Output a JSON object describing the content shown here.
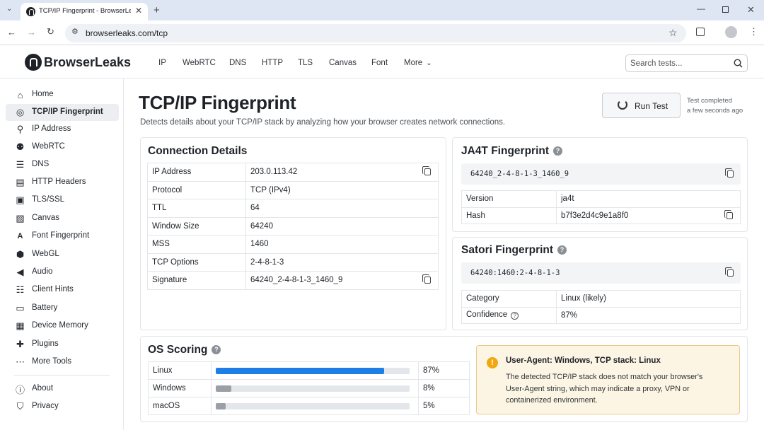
{
  "browser": {
    "tab_title": "TCP/IP Fingerprint - BrowserLeaks",
    "url": "browserleaks.com/tcp"
  },
  "site": {
    "brand": "BrowserLeaks",
    "nav": [
      "IP",
      "WebRTC",
      "DNS",
      "HTTP",
      "TLS",
      "Canvas",
      "Font",
      "More"
    ],
    "search_placeholder": "Search tests..."
  },
  "sidebar": {
    "items": [
      {
        "label": "Home",
        "icon": "home-icon",
        "active": false
      },
      {
        "label": "TCP/IP Fingerprint",
        "icon": "fingerprint-icon",
        "active": true
      },
      {
        "label": "IP Address",
        "icon": "location-pin-icon",
        "active": false
      },
      {
        "label": "WebRTC",
        "icon": "users-icon",
        "active": false
      },
      {
        "label": "DNS",
        "icon": "database-icon",
        "active": false
      },
      {
        "label": "HTTP Headers",
        "icon": "document-icon",
        "active": false
      },
      {
        "label": "TLS/SSL",
        "icon": "lock-icon",
        "active": false
      },
      {
        "label": "Canvas",
        "icon": "image-icon",
        "active": false
      },
      {
        "label": "Font Fingerprint",
        "icon": "font-icon",
        "active": false
      },
      {
        "label": "WebGL",
        "icon": "cube-icon",
        "active": false
      },
      {
        "label": "Audio",
        "icon": "speaker-icon",
        "active": false
      },
      {
        "label": "Client Hints",
        "icon": "list-icon",
        "active": false
      },
      {
        "label": "Battery",
        "icon": "battery-icon",
        "active": false
      },
      {
        "label": "Device Memory",
        "icon": "chip-icon",
        "active": false
      },
      {
        "label": "Plugins",
        "icon": "puzzle-icon",
        "active": false
      },
      {
        "label": "More Tools",
        "icon": "ellipsis-icon",
        "active": false
      }
    ],
    "bottom_items": [
      {
        "label": "About",
        "icon": "info-icon"
      },
      {
        "label": "Privacy",
        "icon": "shield-icon"
      }
    ]
  },
  "page": {
    "title": "TCP/IP Fingerprint",
    "description": "Detects details about your TCP/IP stack by analyzing how your browser creates network connections.",
    "run_button": "Run Test",
    "status_line1": "Test completed",
    "status_line2": "a few seconds ago"
  },
  "connection": {
    "title": "Connection Details",
    "rows": [
      {
        "label": "IP Address",
        "value": "203.0.113.42",
        "copy": true
      },
      {
        "label": "Protocol",
        "value": "TCP (IPv4)",
        "copy": false
      },
      {
        "label": "TTL",
        "value": "64",
        "copy": false
      },
      {
        "label": "Window Size",
        "value": "64240",
        "copy": false
      },
      {
        "label": "MSS",
        "value": "1460",
        "copy": false
      },
      {
        "label": "TCP Options",
        "value": "2-4-8-1-3",
        "copy": false
      },
      {
        "label": "Signature",
        "value": "64240_2-4-8-1-3_1460_9",
        "copy": true
      }
    ]
  },
  "ja4t": {
    "title": "JA4T Fingerprint",
    "hash": "64240_2-4-8-1-3_1460_9",
    "rows": [
      {
        "label": "Version",
        "value": "ja4t",
        "copy": false
      },
      {
        "label": "Hash",
        "value": "b7f3e2d4c9e1a8f0",
        "copy": true
      }
    ]
  },
  "satori": {
    "title": "Satori Fingerprint",
    "hash": "64240:1460:2-4-8-1-3",
    "rows": [
      {
        "label": "Category",
        "value": "Linux (likely)",
        "info": false
      },
      {
        "label": "Confidence",
        "value": "87%",
        "info": true
      }
    ]
  },
  "os_scoring": {
    "title": "OS Scoring",
    "rows": [
      {
        "os": "Linux",
        "percent": 87,
        "label": "87%",
        "color": "#1e7ee8"
      },
      {
        "os": "Windows",
        "percent": 8,
        "label": "8%",
        "color": "#9aa0a6"
      },
      {
        "os": "macOS",
        "percent": 5,
        "label": "5%",
        "color": "#9aa0a6"
      }
    ]
  },
  "warning": {
    "title": "User-Agent: Windows, TCP stack: Linux",
    "body": "The detected TCP/IP stack does not match your browser's User-Agent string, which may indicate a proxy, VPN or containerized environment."
  }
}
